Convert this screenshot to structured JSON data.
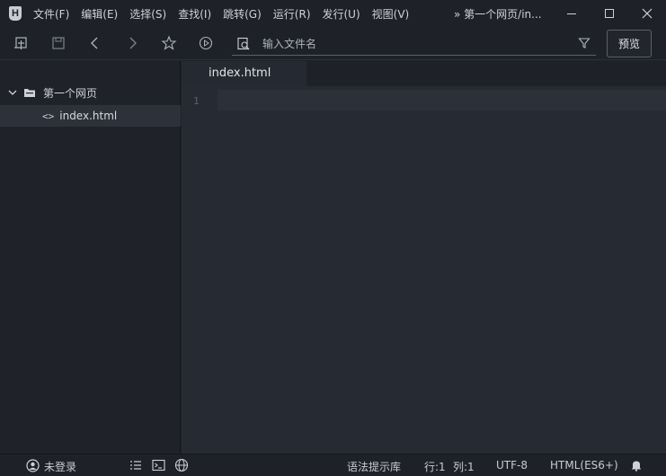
{
  "app": {
    "logo_letter": "H",
    "title_path": "» 第一个网页/in..."
  },
  "menu": [
    {
      "label": "文件(F)"
    },
    {
      "label": "编辑(E)"
    },
    {
      "label": "选择(S)"
    },
    {
      "label": "查找(I)"
    },
    {
      "label": "跳转(G)"
    },
    {
      "label": "运行(R)"
    },
    {
      "label": "发行(U)"
    },
    {
      "label": "视图(V)"
    }
  ],
  "toolbar": {
    "search_placeholder": "输入文件名",
    "preview_label": "预览"
  },
  "sidebar": {
    "project_name": "第一个网页",
    "files": [
      {
        "icon_text": "<>",
        "name": "index.html"
      }
    ]
  },
  "editor": {
    "tab_label": "index.html",
    "line_numbers": [
      "1"
    ]
  },
  "statusbar": {
    "login_label": "未登录",
    "syntax_lib": "语法提示库",
    "row": "行:1",
    "col": "列:1",
    "encoding": "UTF-8",
    "language": "HTML(ES6+)"
  },
  "colors": {
    "background": "#1e2128",
    "editor_bg": "#262a33",
    "selected_row": "#2d3139",
    "text": "#c8ccd2"
  }
}
